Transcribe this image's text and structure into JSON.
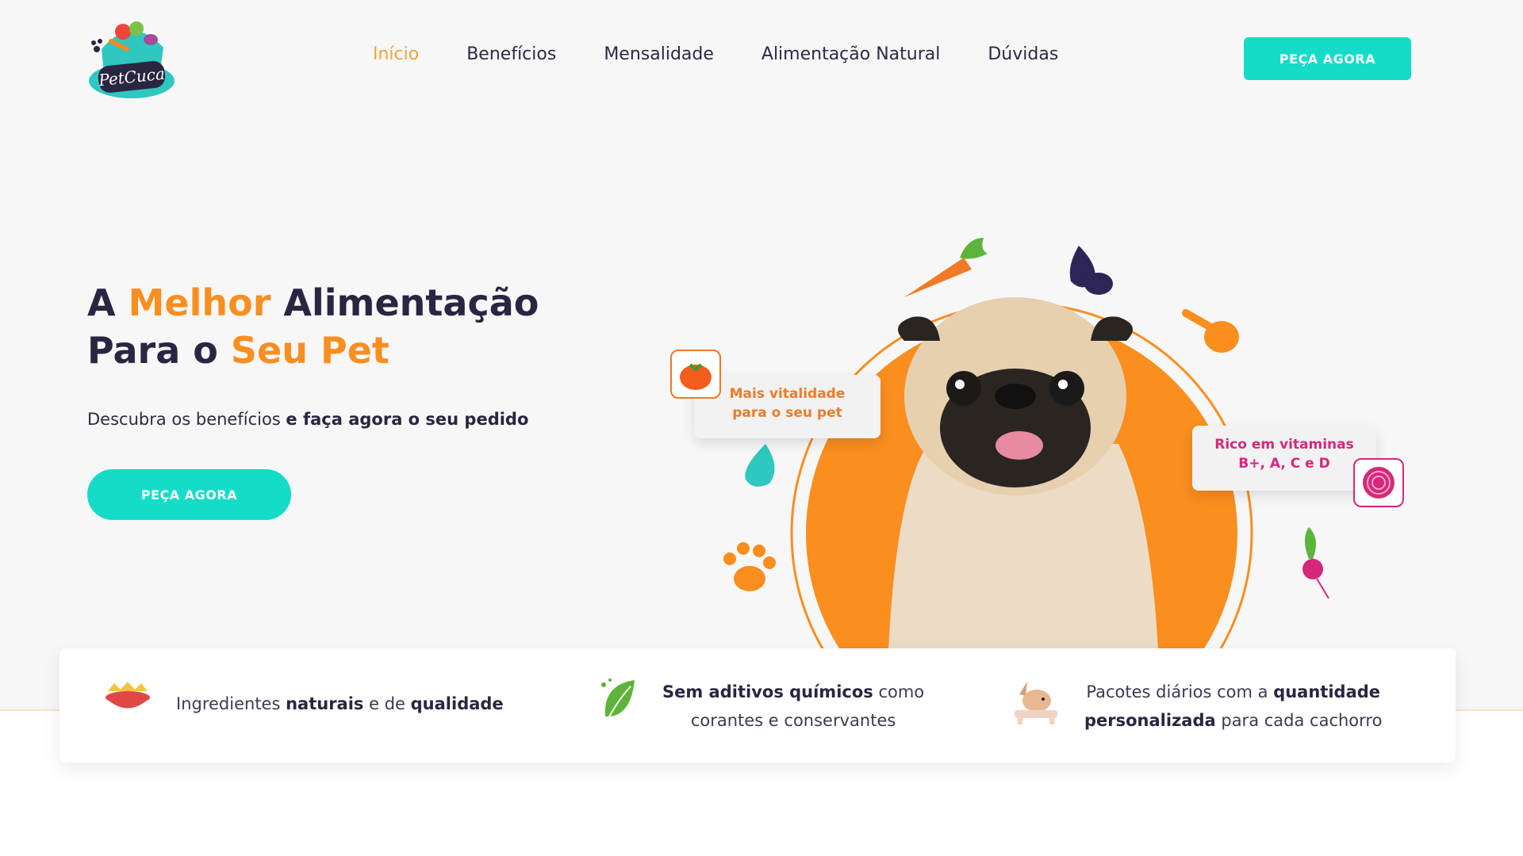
{
  "brand": {
    "name": "PetCuca"
  },
  "nav": {
    "items": [
      {
        "label": "Início",
        "active": true
      },
      {
        "label": "Benefícios",
        "active": false
      },
      {
        "label": "Mensalidade",
        "active": false
      },
      {
        "label": "Alimentação Natural",
        "active": false
      },
      {
        "label": "Dúvidas",
        "active": false
      }
    ],
    "cta_label": "PEÇA AGORA"
  },
  "hero": {
    "title_1": "A ",
    "title_2": "Melhor",
    "title_3": " Alimentação",
    "title_4": "Para o ",
    "title_5": "Seu Pet",
    "subtitle_plain": "Descubra os benefícios ",
    "subtitle_bold": "e faça agora o seu pedido",
    "cta_label": "PEÇA AGORA"
  },
  "illustration": {
    "tag_vitality_line1": "Mais vitalidade",
    "tag_vitality_line2": "para o seu pet",
    "tag_vitamins_line1": "Rico em vitaminas",
    "tag_vitamins_line2": "B+, A, C e D"
  },
  "features": {
    "f1": {
      "t1": "Ingredientes ",
      "b1": "naturais",
      "t2": " e de ",
      "b2": "qualidade"
    },
    "f2": {
      "b1": "Sem aditivos químicos",
      "t1": " como",
      "t2": "corantes e conservantes"
    },
    "f3": {
      "t1": "Pacotes diários com a ",
      "b1": "quantidade",
      "b2": "personalizada",
      "t2": " para cada cachorro"
    }
  },
  "colors": {
    "accent_teal": "#14dcc8",
    "accent_orange": "#fa8e1f",
    "dark_text": "#2a2540",
    "beet_pink": "#d6287a"
  }
}
